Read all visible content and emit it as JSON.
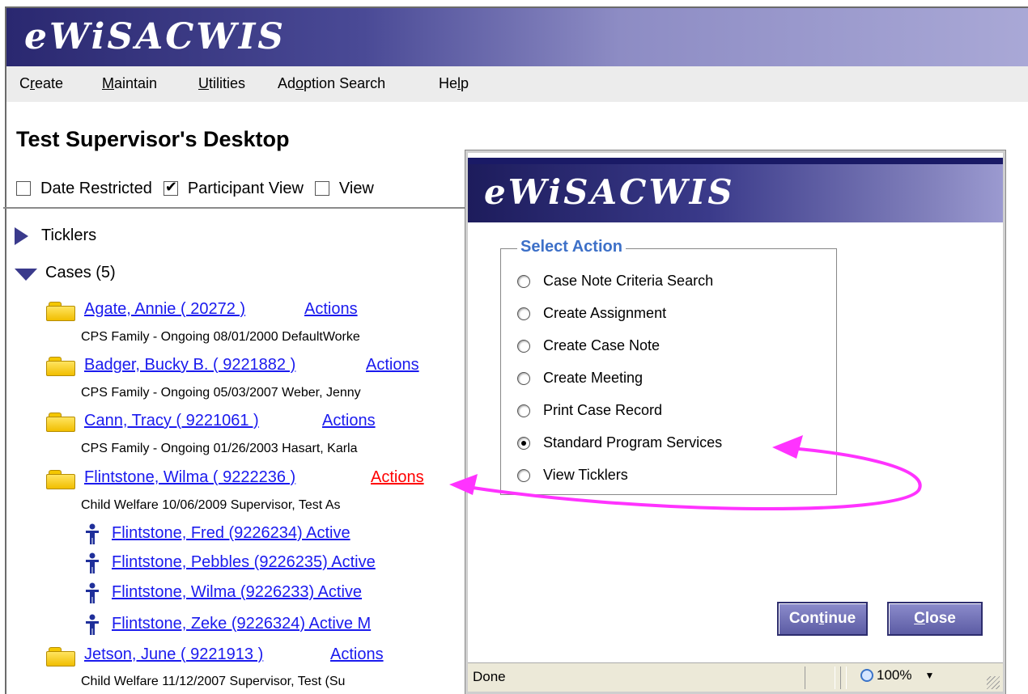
{
  "app": {
    "title": "eWiSACWIS"
  },
  "menu": {
    "items": [
      {
        "pre": "C",
        "u": "r",
        "post": "eate"
      },
      {
        "pre": "",
        "u": "M",
        "post": "aintain"
      },
      {
        "pre": "",
        "u": "U",
        "post": "tilities"
      },
      {
        "pre": "Ad",
        "u": "o",
        "post": "ption Search"
      },
      {
        "pre": "He",
        "u": "l",
        "post": "p"
      }
    ]
  },
  "desktop": {
    "title": "Test Supervisor's Desktop",
    "filters": [
      {
        "label": "Date Restricted",
        "checked": false
      },
      {
        "label": "Participant View",
        "checked": true
      },
      {
        "label": "View",
        "checked": false
      }
    ],
    "ticklers_label": "Ticklers",
    "cases_label": "Cases (5)",
    "cases": [
      {
        "name": "Agate, Annie ( 20272 )",
        "actions": "Actions",
        "detail": "CPS Family - Ongoing   08/01/2000   DefaultWorke"
      },
      {
        "name": "Badger, Bucky B. ( 9221882 )",
        "actions": "Actions",
        "detail": "CPS Family - Ongoing   05/03/2007   Weber, Jenny"
      },
      {
        "name": "Cann, Tracy ( 9221061 )",
        "actions": "Actions",
        "detail": "CPS Family - Ongoing   01/26/2003   Hasart, Karla"
      },
      {
        "name": "Flintstone, Wilma ( 9222236 )",
        "actions": "Actions",
        "detail": "Child Welfare   10/06/2009   Supervisor, Test   As"
      },
      {
        "name": "Jetson, June ( 9221913 )",
        "actions": "Actions",
        "detail": "Child Welfare   11/12/2007   Supervisor, Test (Su"
      }
    ],
    "participants": [
      "Flintstone, Fred    (9226234)   Active",
      "Flintstone, Pebbles    (9226235)   Active",
      "Flintstone, Wilma    (9226233)   Active",
      "Flintstone, Zeke    (9226324)   Active   M"
    ]
  },
  "popup": {
    "title": "eWiSACWIS",
    "legend": "Select Action",
    "options": [
      {
        "label": "Case Note Criteria Search",
        "selected": false
      },
      {
        "label": "Create Assignment",
        "selected": false
      },
      {
        "label": "Create Case Note",
        "selected": false
      },
      {
        "label": "Create Meeting",
        "selected": false
      },
      {
        "label": "Print Case Record",
        "selected": false
      },
      {
        "label": "Standard Program Services",
        "selected": true
      },
      {
        "label": "View Ticklers",
        "selected": false
      }
    ],
    "continue_label": {
      "pre": "Con",
      "u": "t",
      "post": "inue"
    },
    "close_label": {
      "pre": "",
      "u": "C",
      "post": "lose"
    },
    "status_text": "Done",
    "zoom": "100%"
  },
  "colors": {
    "link": "#1a1aee",
    "active_link": "#ff0000",
    "legend": "#3d70c8",
    "annotation_arrow": "#ff33ff"
  }
}
